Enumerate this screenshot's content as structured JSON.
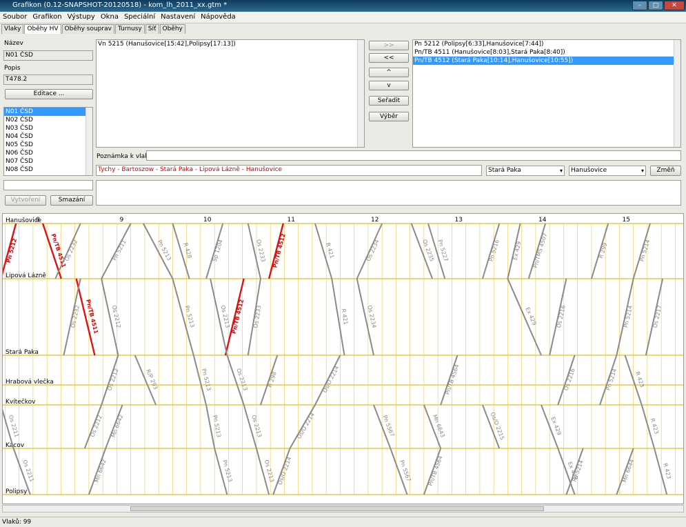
{
  "window": {
    "title": "Grafikon (0.12-SNAPSHOT-20120518) - kom_lh_2011_xx.gtm *"
  },
  "menu": [
    "Soubor",
    "Grafikon",
    "Výstupy",
    "Okna",
    "Speciální",
    "Nastavení",
    "Nápověda"
  ],
  "tabs": [
    "Vlaky",
    "Oběhy HV",
    "Oběhy souprav",
    "Turnusy",
    "Síť",
    "Oběhy"
  ],
  "left": {
    "name_label": "Název",
    "name_value": "N01 ČSD",
    "desc_label": "Popis",
    "desc_value": "T478.2",
    "edit_btn": "Editace ...",
    "list": [
      "N01 ČSD",
      "N02 ČSD",
      "N03 ČSD",
      "N04 ČSD",
      "N05 ČSD",
      "N06 ČSD",
      "N07 ČSD",
      "N08 ČSD"
    ],
    "create_btn": "Vytvoření",
    "delete_btn": "Smazání"
  },
  "center": {
    "available": [
      "Vn 5215 (Hanušovice[15:42],Polipsy[17:13])"
    ],
    "note_label": "Poznámka k vlaku:",
    "route": "Tychy - Bartoszow - Stará Paka - Lipová Lázně - Hanušovice",
    "from_combo": "Stará Paka",
    "to_combo": "Hanušovice",
    "change_btn": "Změň"
  },
  "buttons": {
    "add_all": ">>",
    "remove": "<<",
    "up": "^",
    "down": "v",
    "sort": "Seřadit",
    "select": "Výběr"
  },
  "assigned": [
    "Pn 5212 (Polipsy[6:33],Hanušovice[7:44])",
    "Pn/TB 4511 (Hanušovice[8:03],Stará Paka[8:40])",
    "Pn/TB 4512 (Stará Paka[10:14],Hanušovice[10:55])"
  ],
  "chart_data": {
    "type": "line",
    "x_ticks": [
      "8",
      "9",
      "10",
      "11",
      "12",
      "13",
      "14",
      "15"
    ],
    "stations": [
      "Hanušovice",
      "Lipová Lázně",
      "Stará Paka",
      "Hrabová vlečka",
      "Kvítečkov",
      "Kácov",
      "Polipsy"
    ],
    "trains": [
      {
        "name": "Pn 5212",
        "highlight": true,
        "points": [
          [
            7.55,
            1
          ],
          [
            7.73,
            0
          ]
        ]
      },
      {
        "name": "Pn/TB 4511",
        "highlight": true,
        "points": [
          [
            8.05,
            0
          ],
          [
            8.27,
            1
          ]
        ]
      },
      {
        "name": "Pn/TB 4511",
        "highlight": true,
        "points": [
          [
            8.45,
            1
          ],
          [
            8.67,
            2
          ]
        ]
      },
      {
        "name": "Pn/TB 4512",
        "highlight": true,
        "points": [
          [
            10.23,
            2
          ],
          [
            10.45,
            1
          ]
        ]
      },
      {
        "name": "Pn/TB 4512",
        "highlight": true,
        "points": [
          [
            10.75,
            1
          ],
          [
            10.92,
            0
          ]
        ]
      },
      {
        "name": "Os 2232",
        "points": [
          [
            8.2,
            1
          ],
          [
            8.5,
            0
          ]
        ]
      },
      {
        "name": "Pn 5211",
        "points": [
          [
            9.1,
            0
          ],
          [
            8.75,
            1
          ]
        ]
      },
      {
        "name": "Pn 5213",
        "points": [
          [
            9.25,
            0
          ],
          [
            9.6,
            1
          ]
        ]
      },
      {
        "name": "R 428",
        "points": [
          [
            9.6,
            0
          ],
          [
            9.8,
            1
          ]
        ]
      },
      {
        "name": "Sp 1204",
        "points": [
          [
            10.2,
            0
          ],
          [
            10.0,
            1
          ]
        ]
      },
      {
        "name": "Os 2233",
        "points": [
          [
            10.5,
            0
          ],
          [
            10.65,
            1
          ]
        ]
      },
      {
        "name": "R 421",
        "points": [
          [
            11.3,
            0
          ],
          [
            11.5,
            1
          ]
        ]
      },
      {
        "name": "Os 2234",
        "points": [
          [
            12.1,
            0
          ],
          [
            11.8,
            1
          ]
        ]
      },
      {
        "name": "Os 2235",
        "points": [
          [
            12.45,
            0
          ],
          [
            12.7,
            1
          ]
        ]
      },
      {
        "name": "Pn 5227",
        "points": [
          [
            12.65,
            0
          ],
          [
            12.85,
            1
          ]
        ]
      },
      {
        "name": "Pn 5216",
        "points": [
          [
            13.5,
            0
          ],
          [
            13.3,
            1
          ]
        ]
      },
      {
        "name": "Ex 429",
        "points": [
          [
            13.75,
            0
          ],
          [
            13.6,
            1
          ]
        ]
      },
      {
        "name": "Pn/TMS 4507",
        "points": [
          [
            14.05,
            0
          ],
          [
            13.85,
            1
          ]
        ]
      },
      {
        "name": "R 299",
        "points": [
          [
            14.8,
            0
          ],
          [
            14.6,
            1
          ]
        ]
      },
      {
        "name": "Pn 5214",
        "points": [
          [
            15.3,
            0
          ],
          [
            15.1,
            1
          ]
        ]
      },
      {
        "name": "Os 2232",
        "points": [
          [
            8.5,
            1
          ],
          [
            8.3,
            2
          ]
        ]
      },
      {
        "name": "Os 2212",
        "points": [
          [
            8.75,
            1
          ],
          [
            8.95,
            2
          ]
        ]
      },
      {
        "name": "Pn 5213",
        "points": [
          [
            9.6,
            1
          ],
          [
            9.85,
            2
          ]
        ]
      },
      {
        "name": "Os 2213",
        "points": [
          [
            10.05,
            1
          ],
          [
            10.25,
            2
          ]
        ]
      },
      {
        "name": "Os 2233",
        "points": [
          [
            10.65,
            1
          ],
          [
            10.5,
            2
          ]
        ]
      },
      {
        "name": "R 421",
        "points": [
          [
            11.5,
            1
          ],
          [
            11.65,
            2
          ]
        ]
      },
      {
        "name": "Os 2234",
        "points": [
          [
            11.8,
            1
          ],
          [
            12.0,
            2
          ]
        ]
      },
      {
        "name": "Ex 429",
        "points": [
          [
            13.6,
            1
          ],
          [
            14.0,
            2
          ]
        ]
      },
      {
        "name": "Os 2216",
        "points": [
          [
            14.3,
            1
          ],
          [
            14.1,
            2
          ]
        ]
      },
      {
        "name": "Pn 5214",
        "points": [
          [
            15.1,
            1
          ],
          [
            14.9,
            2
          ]
        ]
      },
      {
        "name": "Os 2217",
        "points": [
          [
            15.45,
            1
          ],
          [
            15.25,
            2
          ]
        ]
      },
      {
        "name": "Os 2212",
        "points": [
          [
            8.95,
            2
          ],
          [
            8.75,
            4
          ]
        ]
      },
      {
        "name": "R/P 293",
        "points": [
          [
            9.15,
            2
          ],
          [
            9.4,
            4
          ]
        ]
      },
      {
        "name": "Pn 5213",
        "points": [
          [
            9.85,
            2
          ],
          [
            10.0,
            4
          ]
        ]
      },
      {
        "name": "Os 2213",
        "points": [
          [
            10.25,
            2
          ],
          [
            10.45,
            4
          ]
        ]
      },
      {
        "name": "R 298",
        "points": [
          [
            10.85,
            2
          ],
          [
            10.65,
            4
          ]
        ]
      },
      {
        "name": "Os/O 2214",
        "points": [
          [
            11.6,
            2
          ],
          [
            11.3,
            4
          ]
        ]
      },
      {
        "name": "Pn/TB 4564",
        "points": [
          [
            13.0,
            2
          ],
          [
            12.8,
            4
          ]
        ]
      },
      {
        "name": "Os 2216",
        "points": [
          [
            14.4,
            2
          ],
          [
            14.2,
            4
          ]
        ]
      },
      {
        "name": "Pn 5214",
        "points": [
          [
            14.9,
            2
          ],
          [
            14.7,
            4
          ]
        ]
      },
      {
        "name": "R 423",
        "points": [
          [
            15.0,
            2
          ],
          [
            15.2,
            4
          ]
        ]
      },
      {
        "name": "Os 2211",
        "points": [
          [
            7.55,
            4
          ],
          [
            7.7,
            5
          ]
        ]
      },
      {
        "name": "Os 2212",
        "points": [
          [
            8.75,
            4
          ],
          [
            8.55,
            5
          ]
        ]
      },
      {
        "name": "Mn 6642",
        "points": [
          [
            9.0,
            4
          ],
          [
            8.8,
            5
          ]
        ]
      },
      {
        "name": "Pn 5213",
        "points": [
          [
            10.0,
            4
          ],
          [
            10.1,
            5
          ]
        ]
      },
      {
        "name": "Os 2213",
        "points": [
          [
            10.45,
            4
          ],
          [
            10.6,
            5
          ]
        ]
      },
      {
        "name": "Os/O 2214",
        "points": [
          [
            11.3,
            4
          ],
          [
            11.0,
            5
          ]
        ]
      },
      {
        "name": "Pn 5567",
        "points": [
          [
            12.0,
            4
          ],
          [
            12.2,
            5
          ]
        ]
      },
      {
        "name": "Mn 6643",
        "points": [
          [
            12.6,
            4
          ],
          [
            12.8,
            5
          ]
        ]
      },
      {
        "name": "Os/O 2215",
        "points": [
          [
            13.3,
            4
          ],
          [
            13.5,
            5
          ]
        ]
      },
      {
        "name": "Ex 429",
        "points": [
          [
            14.0,
            4
          ],
          [
            14.2,
            5
          ]
        ]
      },
      {
        "name": "R 423",
        "points": [
          [
            15.2,
            4
          ],
          [
            15.35,
            5
          ]
        ]
      },
      {
        "name": "Os 2211",
        "points": [
          [
            7.7,
            5
          ],
          [
            7.9,
            6
          ]
        ]
      },
      {
        "name": "Mn 6642",
        "points": [
          [
            8.8,
            5
          ],
          [
            8.6,
            6
          ]
        ]
      },
      {
        "name": "Pn 5213",
        "points": [
          [
            10.1,
            5
          ],
          [
            10.25,
            6
          ]
        ]
      },
      {
        "name": "Os 2213",
        "points": [
          [
            10.6,
            5
          ],
          [
            10.75,
            6
          ]
        ]
      },
      {
        "name": "Os/O 2214",
        "points": [
          [
            11.0,
            5
          ],
          [
            10.8,
            6
          ]
        ]
      },
      {
        "name": "Pn 5567",
        "points": [
          [
            12.2,
            5
          ],
          [
            12.4,
            6
          ]
        ]
      },
      {
        "name": "Pn/TB 4564",
        "points": [
          [
            12.8,
            5
          ],
          [
            12.6,
            6
          ]
        ]
      },
      {
        "name": "Pn 5214",
        "points": [
          [
            14.5,
            5
          ],
          [
            14.3,
            6
          ]
        ]
      },
      {
        "name": "Ex 429",
        "points": [
          [
            14.2,
            5
          ],
          [
            14.4,
            6
          ]
        ]
      },
      {
        "name": "Mn 6644",
        "points": [
          [
            15.1,
            5
          ],
          [
            14.9,
            6
          ]
        ]
      },
      {
        "name": "R 423",
        "points": [
          [
            15.35,
            5
          ],
          [
            15.5,
            6
          ]
        ]
      }
    ]
  },
  "status": "Vlaků: 99"
}
